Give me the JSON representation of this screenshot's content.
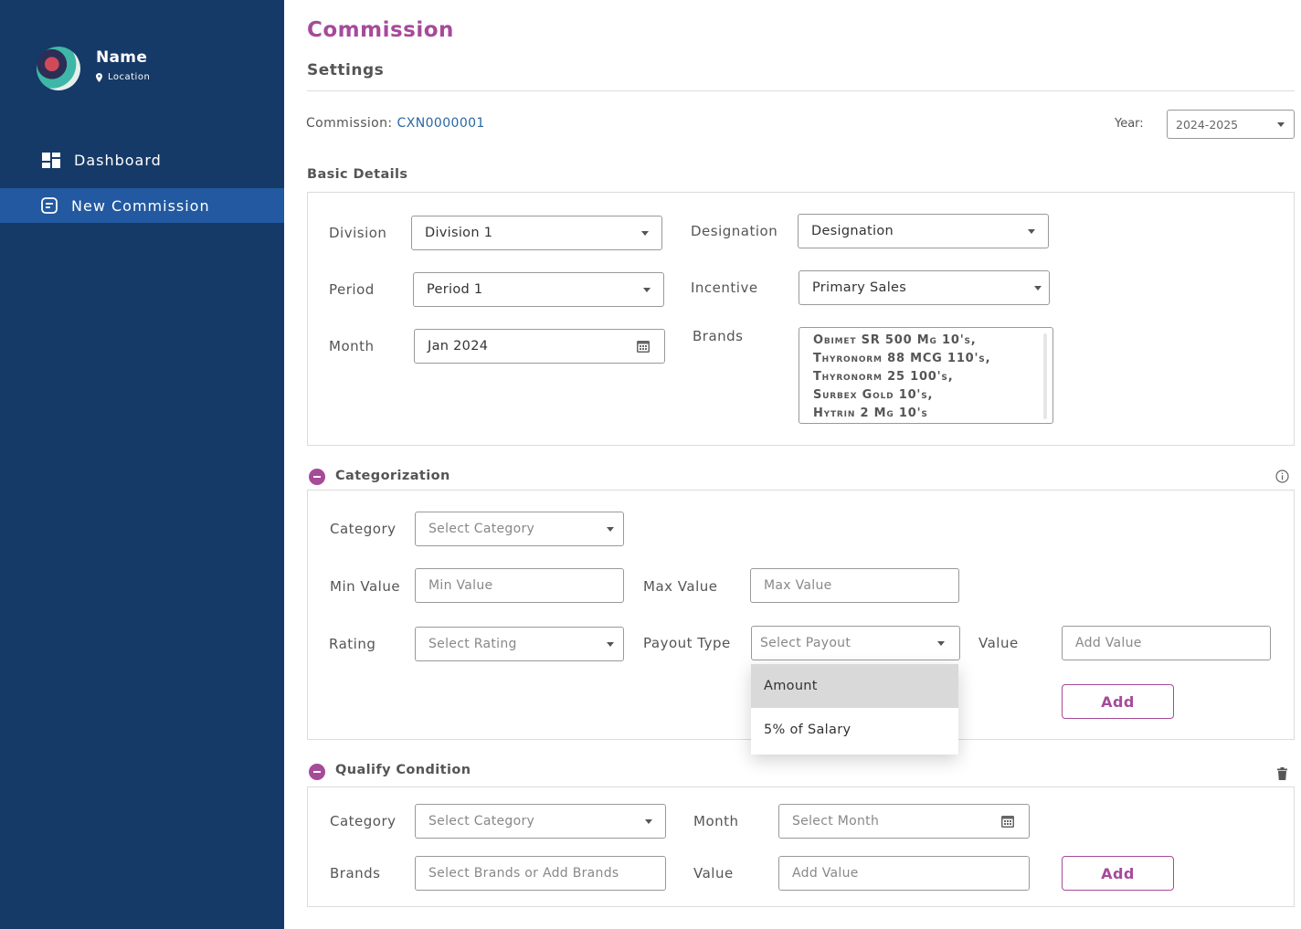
{
  "profile": {
    "name": "Name",
    "location": "Location"
  },
  "nav": {
    "dashboard": "Dashboard",
    "new_commission": "New Commission"
  },
  "header": {
    "title": "Commission",
    "subtitle": "Settings"
  },
  "commission": {
    "label": "Commission:",
    "id": "CXN0000001"
  },
  "year": {
    "label": "Year:",
    "value": "2024-2025"
  },
  "basic": {
    "heading": "Basic Details",
    "division_label": "Division",
    "division_value": "Division 1",
    "period_label": "Period",
    "period_value": "Period 1",
    "month_label": "Month",
    "month_value": "Jan 2024",
    "designation_label": "Designation",
    "designation_value": "Designation",
    "incentive_label": "Incentive",
    "incentive_value": "Primary Sales",
    "brands_label": "Brands",
    "brands": [
      "Obimet SR 500 Mg 10's,",
      "Thyronorm 88 MCG 110's,",
      "Thyronorm 25 100's,",
      "Surbex Gold 10's,",
      "Hytrin 2 Mg 10's"
    ]
  },
  "categorization": {
    "heading": "Categorization",
    "category_label": "Category",
    "category_placeholder": "Select Category",
    "min_label": "Min Value",
    "min_placeholder": "Min Value",
    "max_label": "Max Value",
    "max_placeholder": "Max Value",
    "rating_label": "Rating",
    "rating_placeholder": "Select Rating",
    "payout_label": "Payout Type",
    "payout_placeholder": "Select Payout",
    "value_label": "Value",
    "value_placeholder": "Add Value",
    "add_label": "Add",
    "payout_options": [
      "Amount",
      "5% of Salary"
    ]
  },
  "qualify": {
    "heading": "Qualify Condition",
    "category_label": "Category",
    "category_placeholder": "Select Category",
    "month_label": "Month",
    "month_placeholder": "Select Month",
    "brands_label": "Brands",
    "brands_placeholder": "Select Brands or Add Brands",
    "value_label": "Value",
    "value_placeholder": "Add Value",
    "add_label": "Add"
  },
  "colors": {
    "sidebar": "#163a67",
    "active_nav": "#2259a0",
    "accent": "#a64a9a",
    "link": "#2a66a3"
  }
}
